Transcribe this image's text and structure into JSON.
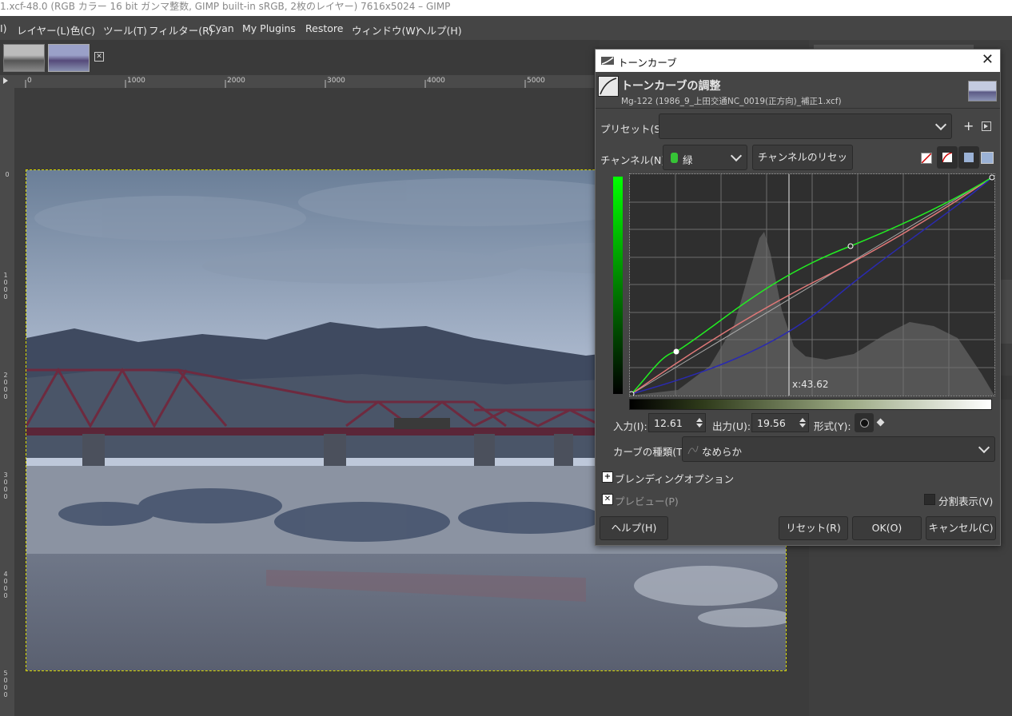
{
  "window": {
    "title": "1.xcf-48.0 (RGB カラー 16 bit ガンマ整数, GIMP built-in sRGB, 2枚のレイヤー) 7616x5024 – GIMP"
  },
  "menu": {
    "items": [
      "I)",
      "レイヤー(L)",
      "色(C)",
      "ツール(T)",
      "フィルター(R)",
      "Cyan",
      "My Plugins",
      "Restore",
      "ウィンドウ(W)",
      "ヘルプ(H)"
    ]
  },
  "rulers": {
    "h_ticks": [
      "0",
      "1000",
      "2000",
      "3000",
      "4000",
      "5000"
    ],
    "v_ticks": [
      "0",
      "1000",
      "2000",
      "3000",
      "4000",
      "5000"
    ]
  },
  "dialog": {
    "title": "トーンカーブ",
    "heading": "トーンカーブの調整",
    "subtitle": "Mg-122 (1986_9_上田交通NC_0019(正方向)_補正1.xcf)",
    "preset_label": "プリセット(S):",
    "preset_value": "",
    "channel_label": "チャンネル(N):",
    "channel_value": "緑",
    "channel_reset": "チャンネルのリセット(E)",
    "cursor_readout": "x:43.62",
    "input_label": "入力(I):",
    "input_value": "12.61",
    "output_label": "出力(U):",
    "output_value": "19.56",
    "type_label": "形式(Y):",
    "curve_type_label": "カーブの種類(T)",
    "curve_type_value": "なめらか",
    "blending_label": "ブレンディングオプション",
    "preview_label": "プレビュー(P)",
    "split_label": "分割表示(V)",
    "help_btn": "ヘルプ(H)",
    "reset_btn": "リセット(R)",
    "ok_btn": "OK(O)",
    "cancel_btn": "キャンセル(C)"
  },
  "colors": {
    "green_curve": "#22ee22",
    "red_curve": "#e07878",
    "blue_curve": "#2a2ab0"
  }
}
